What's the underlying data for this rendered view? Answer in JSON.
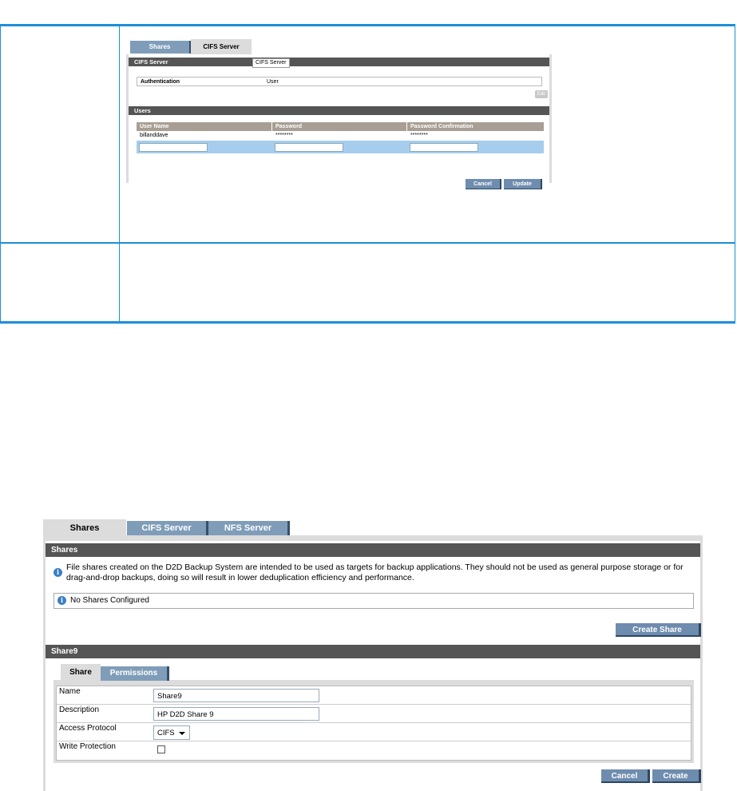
{
  "small_screenshot": {
    "tabs": [
      "Shares",
      "CIFS Server"
    ],
    "section_cifs": "CIFS Server",
    "tooltip": "CIFS Server",
    "auth_label": "Authentication",
    "auth_value": "User",
    "edit_label": "Edit",
    "section_users": "Users",
    "columns": [
      "User Name",
      "Password",
      "Password Confirmation"
    ],
    "row": {
      "user": "billanddave",
      "password": "********",
      "confirm": "********"
    },
    "cancel": "Cancel",
    "update": "Update"
  },
  "large_screenshot": {
    "tabs": [
      "Shares",
      "CIFS Server",
      "NFS Server"
    ],
    "section_shares": "Shares",
    "info_text": "File shares created on the D2D Backup System are intended to be used as targets for backup applications. They should not be used as general purpose storage or for drag-and-drop backups, doing so will result in lower deduplication efficiency and performance.",
    "no_shares": "No Shares Configured",
    "create_share": "Create Share",
    "section_share9": "Share9",
    "subtabs": [
      "Share",
      "Permissions"
    ],
    "fields": {
      "name_label": "Name",
      "name_value": "Share9",
      "description_label": "Description",
      "description_value": "HP D2D Share 9",
      "protocol_label": "Access Protocol",
      "protocol_value": "CIFS",
      "write_label": "Write Protection"
    },
    "cancel": "Cancel",
    "create": "Create"
  },
  "colors": {
    "rule_blue": "#1b8fd6",
    "tab_blue": "#7f9db9",
    "header_gray": "#555555"
  }
}
